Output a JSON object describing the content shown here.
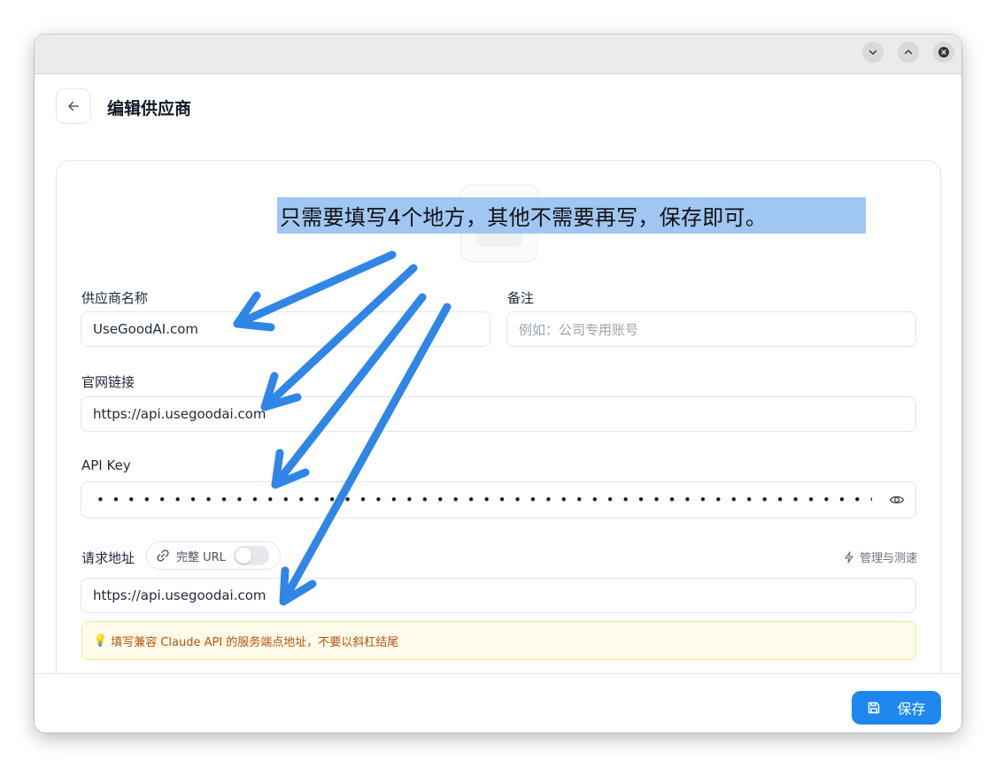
{
  "window": {
    "minimize_icon": "chevron-down-icon",
    "maximize_icon": "chevron-up-icon",
    "close_icon": "close-icon"
  },
  "header": {
    "title": "编辑供应商"
  },
  "form": {
    "provider_name": {
      "label": "供应商名称",
      "value": "UseGoodAI.com"
    },
    "notes": {
      "label": "备注",
      "placeholder": "例如：公司专用账号"
    },
    "website": {
      "label": "官网链接",
      "value": "https://api.usegoodai.com"
    },
    "api_key": {
      "label": "API Key",
      "masked": "••••••••••••••••••••••••••••••••••••••••••••••••••••••••••••••••••••••••••••••••"
    },
    "request_url": {
      "label": "请求地址",
      "full_url_label": "完整 URL",
      "full_url_enabled": false,
      "manage_label": "管理与测速",
      "value": "https://api.usegoodai.com",
      "tip": "填写兼容 Claude API 的服务端点地址，不要以斜杠结尾"
    }
  },
  "footer": {
    "save_label": "保存"
  },
  "annotation": {
    "text": "只需要填写4个地方，其他不需要再写，保存即可。",
    "color": "#2f86e6"
  },
  "colors": {
    "accent": "#1e88ee",
    "tip_bg": "#fffbeb",
    "tip_text": "#b45309"
  }
}
